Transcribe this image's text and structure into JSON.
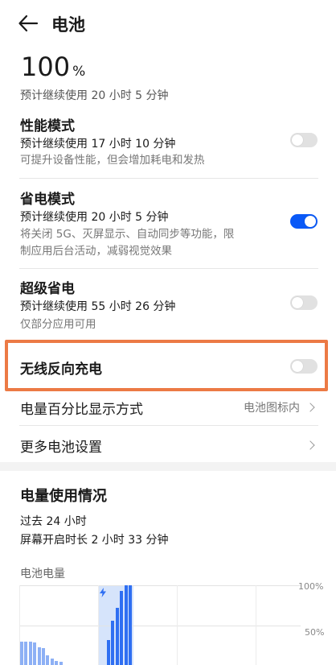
{
  "header": {
    "title": "电池"
  },
  "battery": {
    "percent": "100",
    "percent_unit": "%",
    "estimate": "预计继续使用 20 小时 5 分钟"
  },
  "performance_mode": {
    "title": "性能模式",
    "estimate": "预计继续使用 17 小时 10 分钟",
    "description": "可提升设备性能，但会增加耗电和发热",
    "enabled": false
  },
  "power_saving_mode": {
    "title": "省电模式",
    "estimate": "预计继续使用 20 小时 5 分钟",
    "description_line1": "将关闭 5G、灭屏显示、自动同步等功能，限",
    "description_line2": "制应用后台活动，减弱视觉效果",
    "enabled": true
  },
  "super_power_saving": {
    "title": "超级省电",
    "estimate": "预计继续使用 55 小时 26 分钟",
    "description": "仅部分应用可用",
    "enabled": false
  },
  "wireless_reverse_charging": {
    "title": "无线反向充电",
    "enabled": false
  },
  "percentage_display": {
    "title": "电量百分比显示方式",
    "value": "电池图标内"
  },
  "more_settings": {
    "title": "更多电池设置"
  },
  "usage": {
    "title": "电量使用情况",
    "period": "过去 24 小时",
    "screen_on": "屏幕开启时长 2 小时 33 分钟"
  },
  "chart_data": {
    "type": "bar",
    "title": "电池电量",
    "y_ticks": [
      "100%",
      "50%"
    ],
    "ylim": [
      0,
      100
    ],
    "values": [
      29,
      29,
      29,
      28,
      22,
      21,
      12,
      8,
      5,
      4,
      0,
      0,
      0,
      0,
      0,
      0,
      0,
      0,
      0,
      0,
      31,
      56,
      72,
      93,
      100,
      100
    ]
  },
  "colors": {
    "accent": "#0a59f7",
    "highlight": "#ec7a45",
    "bar": "#8db0f5",
    "bar_charging": "#2f6ff2",
    "charging_bg": "#d6e4fb"
  }
}
